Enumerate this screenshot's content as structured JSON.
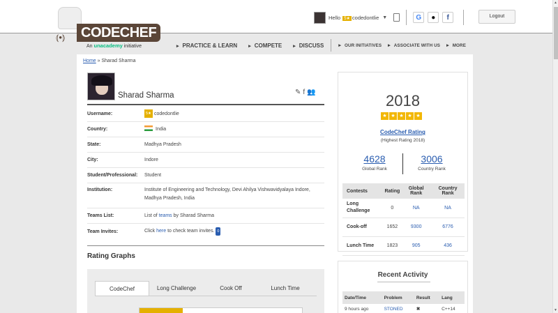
{
  "brand": {
    "name": "CODECHEF",
    "tagline_pre": "An",
    "tagline_brand": "unacademy",
    "tagline_post": "initiative"
  },
  "nav": {
    "practice": "PRACTICE & LEARN",
    "compete": "COMPETE",
    "discuss": "DISCUSS",
    "initiatives": "OUR INITIATIVES",
    "associate": "ASSOCIATE WITH US",
    "more": "MORE"
  },
  "user": {
    "hello": "Hello",
    "stars": "5★",
    "handle": "codedontlie",
    "logout": "Logout"
  },
  "breadcrumb": {
    "home": "Home",
    "sep": " » ",
    "current": "Sharad Sharma"
  },
  "profile": {
    "name": "Sharad Sharma",
    "fields": [
      {
        "key": "Username:",
        "value": "codedontlie",
        "badge": "5★"
      },
      {
        "key": "Country:",
        "value": "India"
      },
      {
        "key": "State:",
        "value": "Madhya Pradesh"
      },
      {
        "key": "City:",
        "value": "Indore"
      },
      {
        "key": "Student/Professional:",
        "value": "Student"
      },
      {
        "key": "Institution:",
        "value": "Institute of Engineering and Technology, Devi Ahilya Vishwavidyalaya Indore, Madhya Pradesh, India"
      },
      {
        "key": "Teams List:",
        "value_pre": "List of ",
        "link": "teams",
        "value_post": " by Sharad Sharma"
      },
      {
        "key": "Team Invites:",
        "value_pre": "Click ",
        "link": "here",
        "value_post": " to check team invites.",
        "count": "0"
      }
    ]
  },
  "rating_graphs": {
    "title": "Rating Graphs",
    "tabs": [
      "CodeChef",
      "Long Challenge",
      "Cook Off",
      "Lunch Time"
    ]
  },
  "rating": {
    "value": "2018",
    "label": "CodeChef Rating",
    "highest": "(Highest Rating 2018)",
    "global_rank": "4628",
    "global_label": "Global Rank",
    "country_rank": "3006",
    "country_label": "Country Rank",
    "table_headers": [
      "Contests",
      "Rating",
      "Global Rank",
      "Country Rank"
    ],
    "table_rows": [
      {
        "contest": "Long Challenge",
        "rating": "0",
        "global": "NA",
        "country": "NA"
      },
      {
        "contest": "Cook-off",
        "rating": "1652",
        "global": "9300",
        "country": "6776"
      },
      {
        "contest": "Lunch Time",
        "rating": "1823",
        "global": "905",
        "country": "436"
      }
    ]
  },
  "activity": {
    "title": "Recent Activity",
    "headers": [
      "Date/Time",
      "Problem",
      "Result",
      "Lang"
    ],
    "rows": [
      {
        "time": "9 hours ago",
        "problem": "STONED",
        "result": "✖",
        "lang": "C++14"
      }
    ]
  },
  "colors": {
    "accent": "#2a5db0",
    "brand": "#5b4638",
    "star": "#e5b000"
  }
}
